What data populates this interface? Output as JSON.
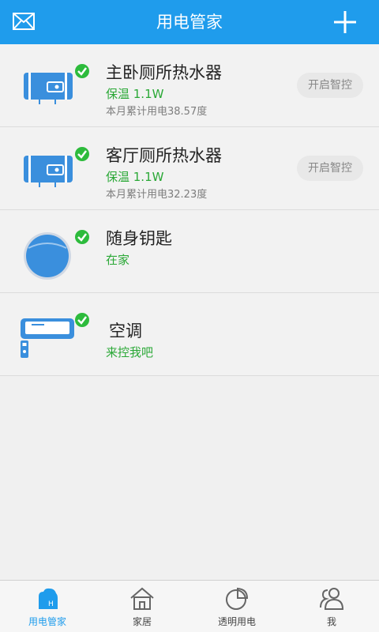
{
  "header": {
    "title": "用电管家",
    "mail_icon": "mail-icon",
    "add_icon": "plus-icon"
  },
  "devices": [
    {
      "name": "主卧厕所热水器",
      "status": "保温 1.1W",
      "usage": "本月累计用电38.57度",
      "action": "开启智控",
      "icon": "water-heater-icon"
    },
    {
      "name": "客厅厕所热水器",
      "status": "保温 1.1W",
      "usage": "本月累计用电32.23度",
      "action": "开启智控",
      "icon": "water-heater-icon"
    },
    {
      "name": "随身钥匙",
      "status": "在家",
      "icon": "key-fob-icon"
    },
    {
      "name": "空调",
      "status": "来控我吧",
      "icon": "air-conditioner-icon"
    }
  ],
  "tabs": [
    {
      "label": "用电管家",
      "icon": "power-manager-icon",
      "active": true
    },
    {
      "label": "家居",
      "icon": "home-icon",
      "active": false
    },
    {
      "label": "透明用电",
      "icon": "pie-chart-icon",
      "active": false
    },
    {
      "label": "我",
      "icon": "user-icon",
      "active": false
    }
  ],
  "colors": {
    "primary": "#1f9cec",
    "status_green": "#2aa836",
    "check_green": "#2dbb3c"
  }
}
